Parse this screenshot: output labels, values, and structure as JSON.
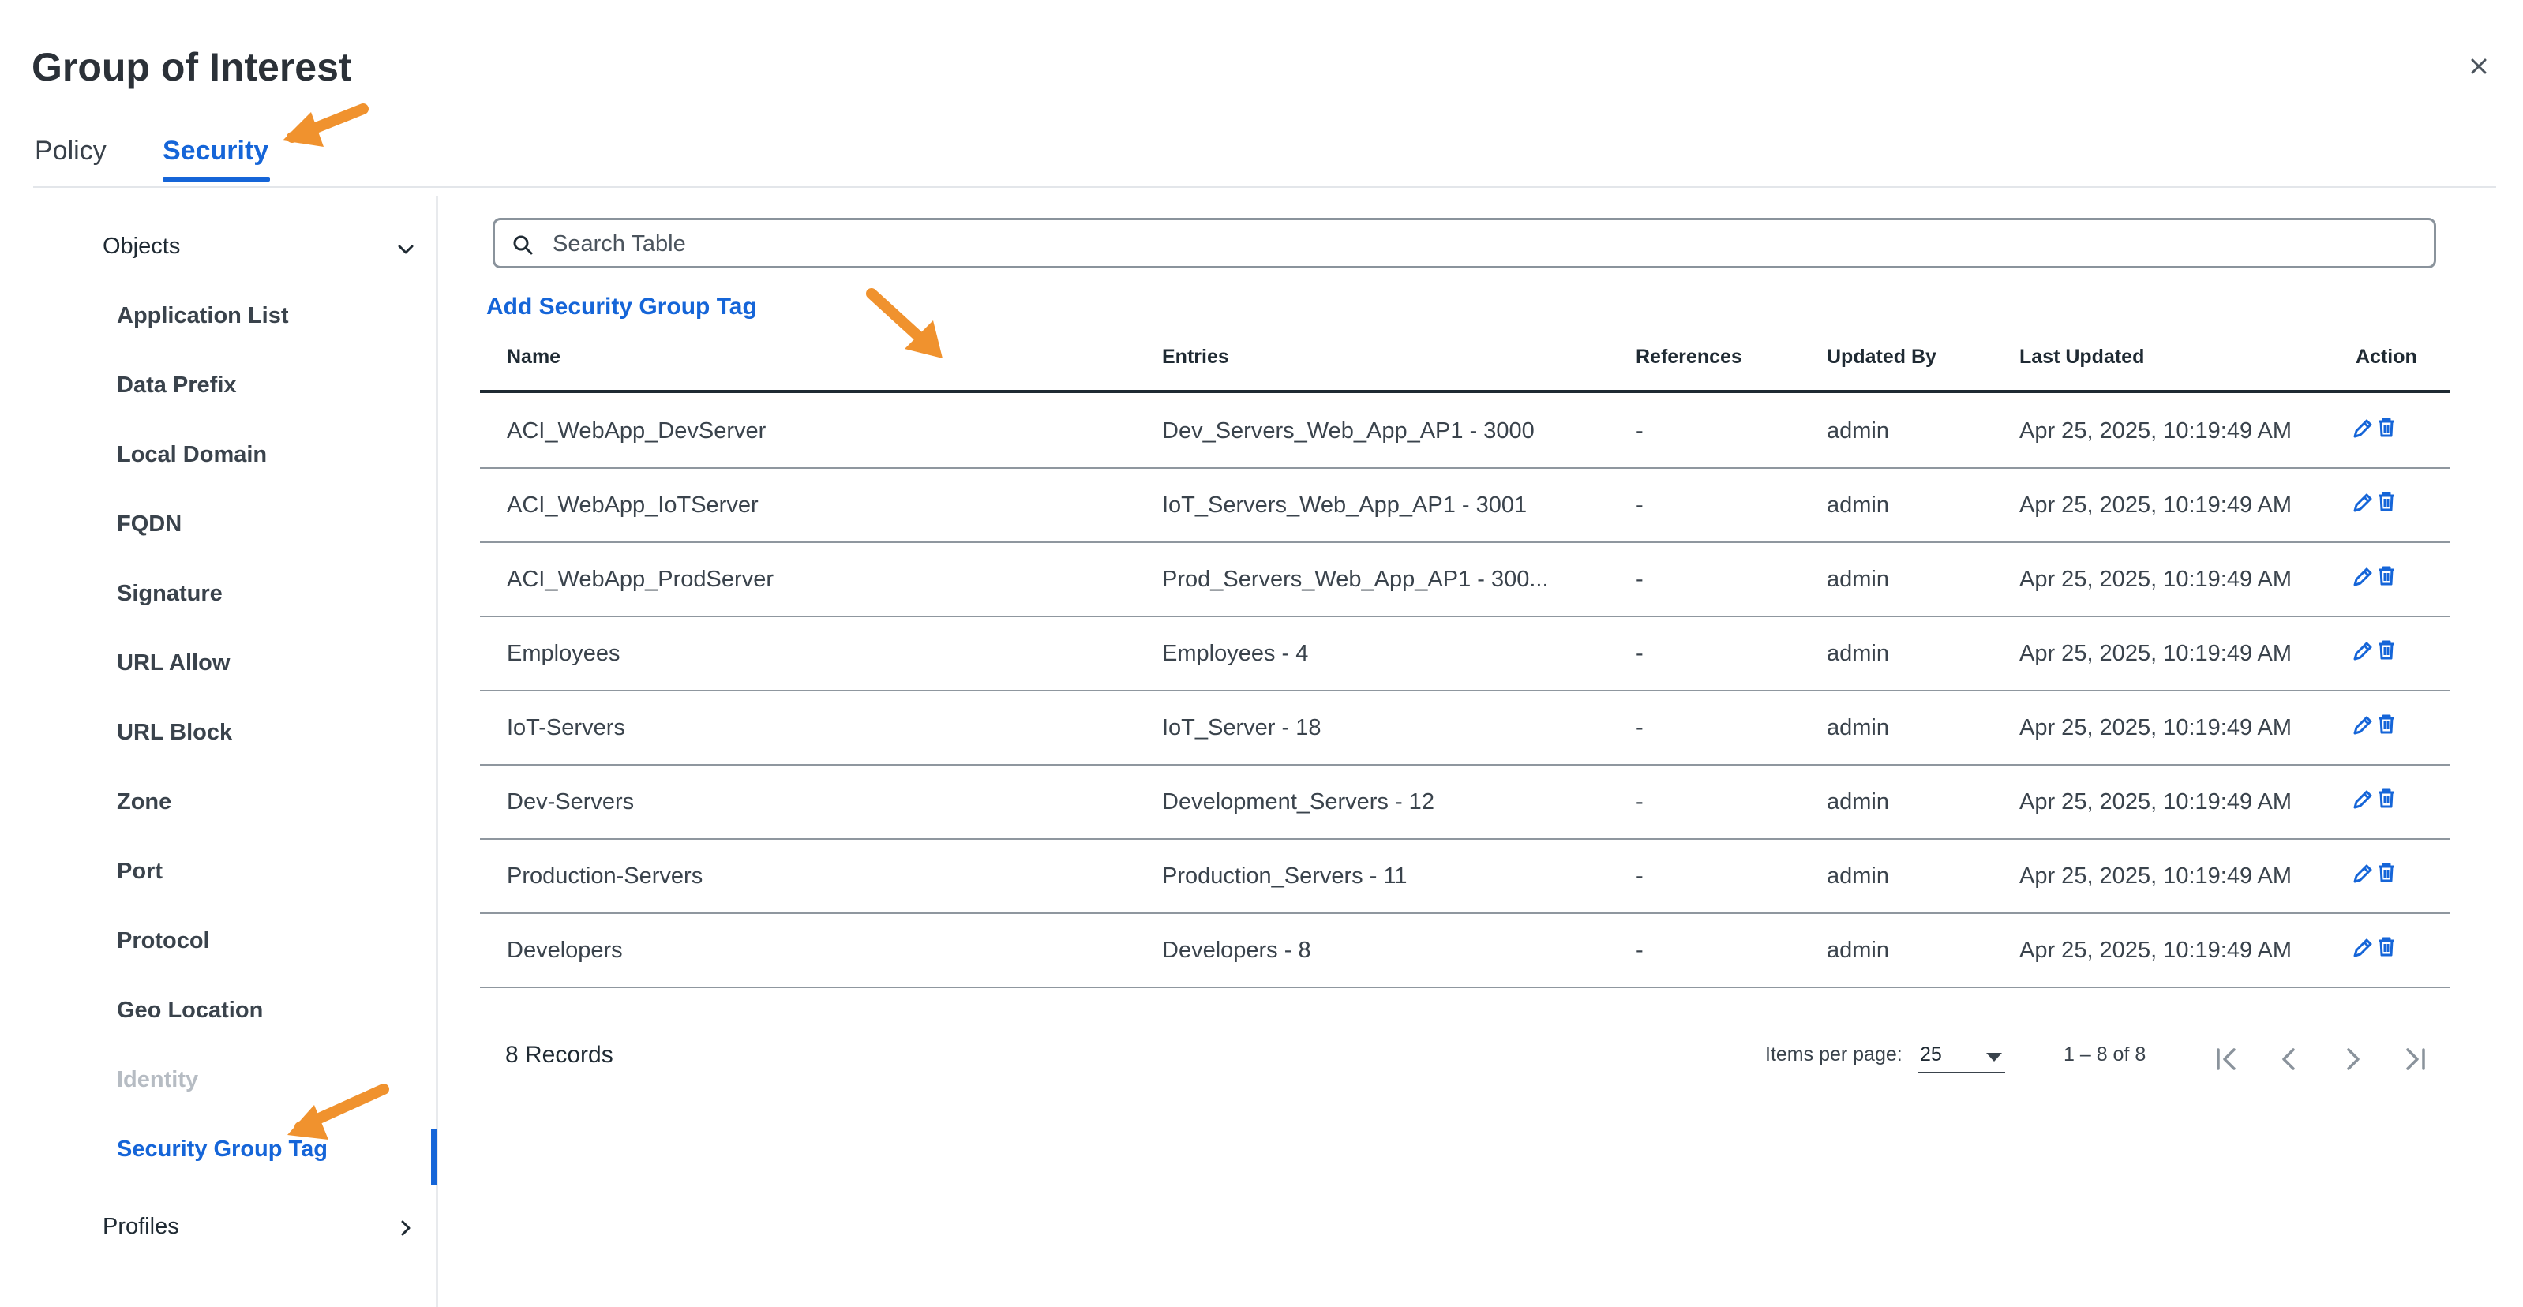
{
  "header": {
    "title": "Group of Interest"
  },
  "tabs": [
    {
      "label": "Policy"
    },
    {
      "label": "Security",
      "active": true
    }
  ],
  "sidebar": {
    "objects_label": "Objects",
    "items": [
      {
        "label": "Application List"
      },
      {
        "label": "Data Prefix"
      },
      {
        "label": "Local Domain"
      },
      {
        "label": "FQDN"
      },
      {
        "label": "Signature"
      },
      {
        "label": "URL Allow"
      },
      {
        "label": "URL Block"
      },
      {
        "label": "Zone"
      },
      {
        "label": "Port"
      },
      {
        "label": "Protocol"
      },
      {
        "label": "Geo Location"
      },
      {
        "label": "Identity",
        "disabled": true
      },
      {
        "label": "Security Group Tag",
        "active": true
      }
    ],
    "profiles_label": "Profiles"
  },
  "search": {
    "placeholder": "Search Table",
    "value": ""
  },
  "add_link": "Add Security Group Tag",
  "table": {
    "columns": [
      "Name",
      "Entries",
      "References",
      "Updated By",
      "Last Updated",
      "Action"
    ],
    "rows": [
      [
        "ACI_WebApp_DevServer",
        "Dev_Servers_Web_App_AP1 - 3000",
        "-",
        "admin",
        "Apr 25, 2025, 10:19:49 AM"
      ],
      [
        "ACI_WebApp_IoTServer",
        "IoT_Servers_Web_App_AP1 - 3001",
        "-",
        "admin",
        "Apr 25, 2025, 10:19:49 AM"
      ],
      [
        "ACI_WebApp_ProdServer",
        "Prod_Servers_Web_App_AP1 - 300...",
        "-",
        "admin",
        "Apr 25, 2025, 10:19:49 AM"
      ],
      [
        "Employees",
        "Employees - 4",
        "-",
        "admin",
        "Apr 25, 2025, 10:19:49 AM"
      ],
      [
        "IoT-Servers",
        "IoT_Server - 18",
        "-",
        "admin",
        "Apr 25, 2025, 10:19:49 AM"
      ],
      [
        "Dev-Servers",
        "Development_Servers - 12",
        "-",
        "admin",
        "Apr 25, 2025, 10:19:49 AM"
      ],
      [
        "Production-Servers",
        "Production_Servers - 11",
        "-",
        "admin",
        "Apr 25, 2025, 10:19:49 AM"
      ],
      [
        "Developers",
        "Developers - 8",
        "-",
        "admin",
        "Apr 25, 2025, 10:19:49 AM"
      ]
    ]
  },
  "footer": {
    "records": "8 Records",
    "items_per_page_label": "Items per page:",
    "items_per_page_value": "25",
    "range": "1 – 8 of 8"
  },
  "icons": {
    "close": "close-icon",
    "search": "search-icon",
    "edit": "pencil-icon",
    "delete": "trash-icon",
    "first_page": "first-page-icon",
    "prev_page": "chevron-left-icon",
    "next_page": "chevron-right-icon",
    "last_page": "last-page-icon"
  },
  "colors": {
    "accent": "#1565d8",
    "annotation": "#f0922e"
  }
}
